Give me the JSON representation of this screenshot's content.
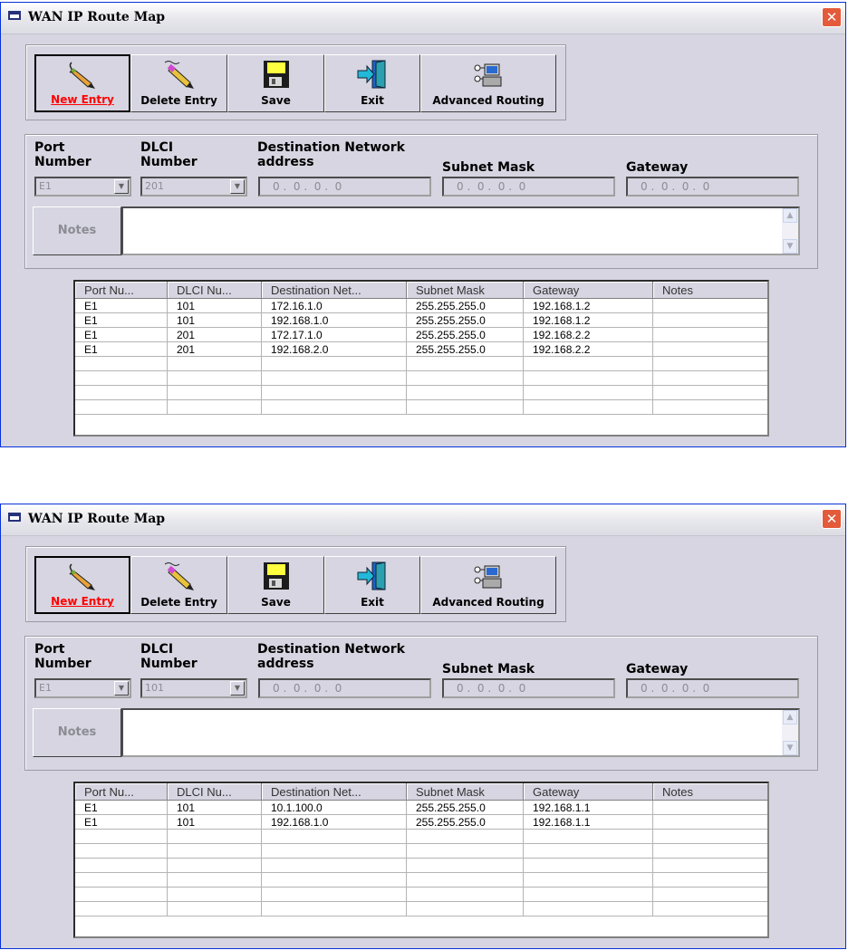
{
  "windows": [
    {
      "title": "WAN IP Route Map",
      "close_glyph": "✕",
      "toolbar": [
        {
          "label": "New Entry",
          "icon": "pen-icon",
          "pressed": true
        },
        {
          "label": "Delete Entry",
          "icon": "eraser-pencil-icon",
          "pressed": false
        },
        {
          "label": "Save",
          "icon": "floppy-disk-icon",
          "pressed": false
        },
        {
          "label": "Exit",
          "icon": "exit-door-icon",
          "pressed": false
        },
        {
          "label": "Advanced Routing",
          "icon": "network-routing-icon",
          "pressed": false
        }
      ],
      "form": {
        "port_label": "Port\nNumber",
        "dlci_label": "DLCI\nNumber",
        "dest_label": "Destination Network\naddress",
        "mask_label": "Subnet Mask",
        "gateway_label": "Gateway",
        "port_value": "E1",
        "dlci_value": "201",
        "dest_value": "0 .  0 .  0 .  0",
        "mask_value": "0 .  0 .  0 .  0",
        "gateway_value": "0 .  0 .  0 .  0",
        "notes_button": "Notes",
        "notes_value": ""
      },
      "table": {
        "columns": [
          "Port Nu...",
          "DLCI Nu...",
          "Destination Net...",
          "Subnet Mask",
          "Gateway",
          "Notes"
        ],
        "rows": [
          [
            "E1",
            "101",
            "172.16.1.0",
            "255.255.255.0",
            "192.168.1.2",
            ""
          ],
          [
            "E1",
            "101",
            "192.168.1.0",
            "255.255.255.0",
            "192.168.1.2",
            ""
          ],
          [
            "E1",
            "201",
            "172.17.1.0",
            "255.255.255.0",
            "192.168.2.2",
            ""
          ],
          [
            "E1",
            "201",
            "192.168.2.0",
            "255.255.255.0",
            "192.168.2.2",
            ""
          ],
          [
            "",
            "",
            "",
            "",
            "",
            ""
          ],
          [
            "",
            "",
            "",
            "",
            "",
            ""
          ],
          [
            "",
            "",
            "",
            "",
            "",
            ""
          ],
          [
            "",
            "",
            "",
            "",
            "",
            ""
          ]
        ]
      }
    },
    {
      "title": "WAN IP Route Map",
      "close_glyph": "✕",
      "toolbar": [
        {
          "label": "New Entry",
          "icon": "pen-icon",
          "pressed": true
        },
        {
          "label": "Delete Entry",
          "icon": "eraser-pencil-icon",
          "pressed": false
        },
        {
          "label": "Save",
          "icon": "floppy-disk-icon",
          "pressed": false
        },
        {
          "label": "Exit",
          "icon": "exit-door-icon",
          "pressed": false
        },
        {
          "label": "Advanced Routing",
          "icon": "network-routing-icon",
          "pressed": false
        }
      ],
      "form": {
        "port_label": "Port\nNumber",
        "dlci_label": "DLCI\nNumber",
        "dest_label": "Destination Network\naddress",
        "mask_label": "Subnet Mask",
        "gateway_label": "Gateway",
        "port_value": "E1",
        "dlci_value": "101",
        "dest_value": "0 .  0 .  0 .  0",
        "mask_value": "0 .  0 .  0 .  0",
        "gateway_value": "0 .  0 .  0 .  0",
        "notes_button": "Notes",
        "notes_value": ""
      },
      "table": {
        "columns": [
          "Port Nu...",
          "DLCI Nu...",
          "Destination Net...",
          "Subnet Mask",
          "Gateway",
          "Notes"
        ],
        "rows": [
          [
            "E1",
            "101",
            "10.1.100.0",
            "255.255.255.0",
            "192.168.1.1",
            ""
          ],
          [
            "E1",
            "101",
            "192.168.1.0",
            "255.255.255.0",
            "192.168.1.1",
            ""
          ],
          [
            "",
            "",
            "",
            "",
            "",
            ""
          ],
          [
            "",
            "",
            "",
            "",
            "",
            ""
          ],
          [
            "",
            "",
            "",
            "",
            "",
            ""
          ],
          [
            "",
            "",
            "",
            "",
            "",
            ""
          ],
          [
            "",
            "",
            "",
            "",
            "",
            ""
          ],
          [
            "",
            "",
            "",
            "",
            "",
            ""
          ]
        ]
      }
    }
  ]
}
